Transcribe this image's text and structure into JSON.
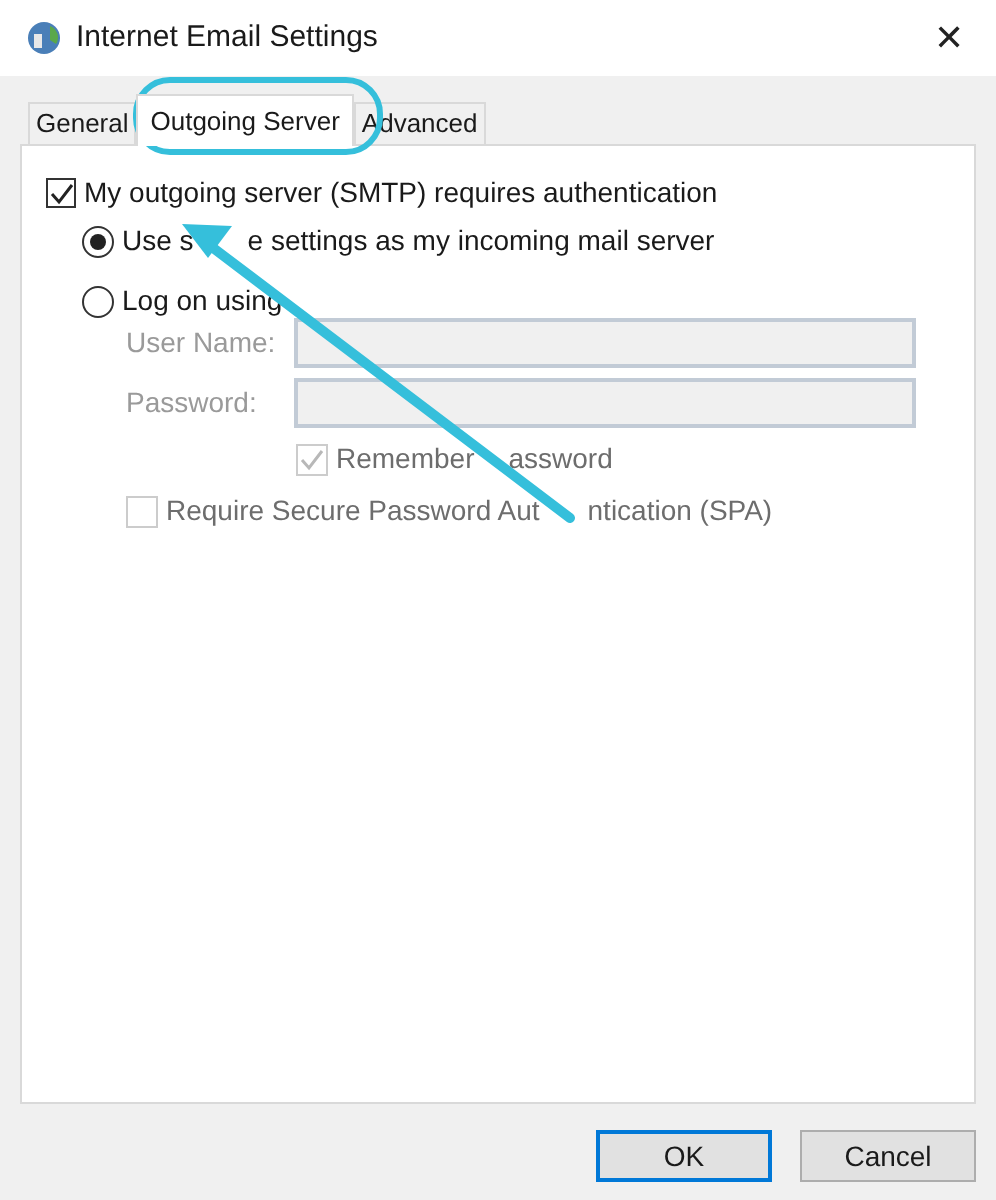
{
  "window": {
    "title": "Internet Email Settings",
    "close": "✕"
  },
  "tabs": [
    {
      "label": "General",
      "selected": false
    },
    {
      "label": "Outgoing Server",
      "selected": true
    },
    {
      "label": "Advanced",
      "selected": false
    }
  ],
  "smtp_auth": {
    "label": "My outgoing server (SMTP) requires authentication",
    "checked": true
  },
  "auth_options": [
    {
      "label_parts": [
        "Use s",
        "e settings as my incoming mail server"
      ],
      "selected": true
    },
    {
      "label_parts": [
        "Log on using"
      ],
      "selected": false
    }
  ],
  "fields": [
    {
      "label": "User Name:",
      "disabled": true
    },
    {
      "label": "Password:",
      "disabled": true
    }
  ],
  "remember_password": {
    "label_parts": [
      "Remember",
      "assword"
    ],
    "checked": true,
    "disabled": true
  },
  "spa": {
    "label_parts": [
      "Require Secure Password Aut",
      "ntication (SPA)"
    ],
    "checked": false,
    "disabled": true
  },
  "buttons": [
    {
      "label": "OK",
      "default": true
    },
    {
      "label": "Cancel",
      "default": false
    }
  ]
}
